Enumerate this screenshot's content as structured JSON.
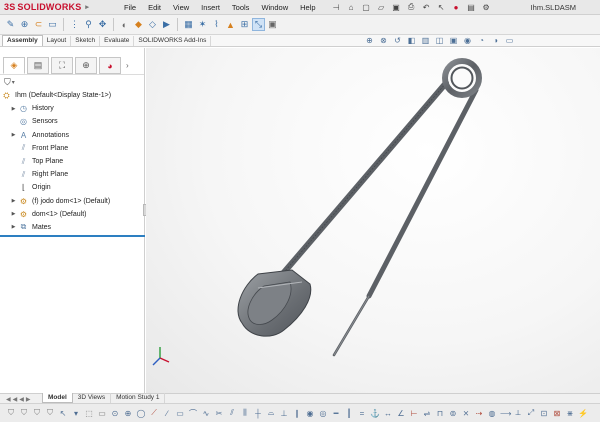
{
  "app": {
    "brand": "SOLIDWORKS",
    "brand_mark": "3S",
    "document_title": "Ihm.SLDASM"
  },
  "menu": {
    "items": [
      "File",
      "Edit",
      "View",
      "Insert",
      "Tools",
      "Window",
      "Help"
    ]
  },
  "command_tabs": [
    "Assembly",
    "Layout",
    "Sketch",
    "Evaluate",
    "SOLIDWORKS Add-Ins"
  ],
  "active_command_tab": "Assembly",
  "feature_tree": {
    "root": "Ihm  (Default<Display State-1>)",
    "items": [
      {
        "label": "History",
        "icon": "history-icon",
        "expandable": true
      },
      {
        "label": "Sensors",
        "icon": "sensors-icon",
        "expandable": false
      },
      {
        "label": "Annotations",
        "icon": "annotations-icon",
        "expandable": true
      },
      {
        "label": "Front Plane",
        "icon": "plane-icon",
        "expandable": false
      },
      {
        "label": "Top Plane",
        "icon": "plane-icon",
        "expandable": false
      },
      {
        "label": "Right Plane",
        "icon": "plane-icon",
        "expandable": false
      },
      {
        "label": "Origin",
        "icon": "origin-icon",
        "expandable": false
      },
      {
        "label": "(f) jodo dom<1> (Default)",
        "icon": "part-icon",
        "expandable": true
      },
      {
        "label": "dom<1> (Default)",
        "icon": "part-icon",
        "expandable": true
      },
      {
        "label": "Mates",
        "icon": "mates-icon",
        "expandable": true
      }
    ]
  },
  "bottom_tabs": [
    "Model",
    "3D Views",
    "Motion Study 1"
  ],
  "active_bottom_tab": "Model",
  "colors": {
    "brand_red": "#c8102e",
    "selection_blue": "#2d7fc1",
    "pin_steel": "#6f7378"
  }
}
